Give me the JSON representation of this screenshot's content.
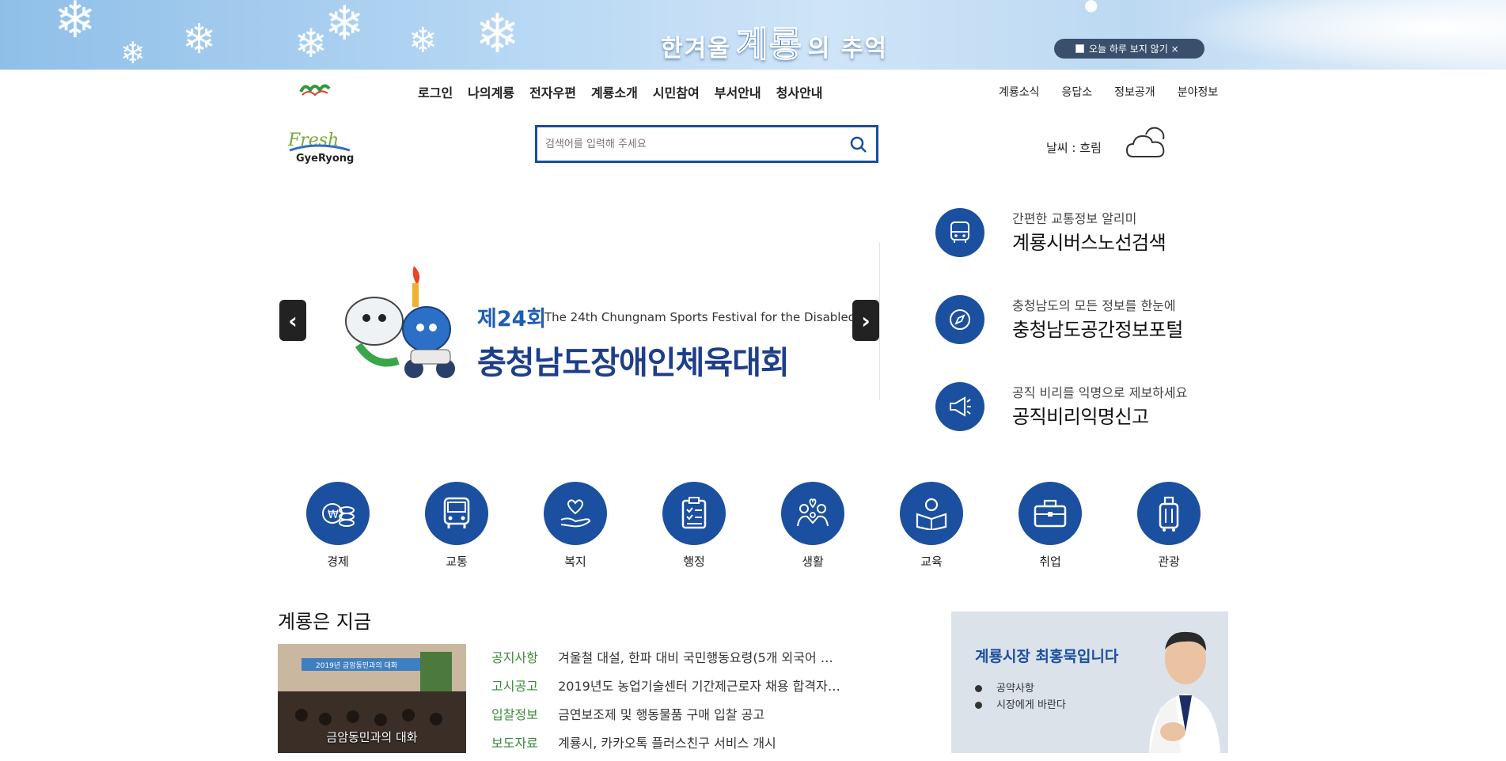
{
  "banner": {
    "title_left": "한겨울",
    "title_big": "계룡",
    "title_right": "의 추억",
    "close_today_label": "오늘 하루 보지 않기 ×"
  },
  "gnb": {
    "logo_text": "계룡시",
    "menu": [
      "로그인",
      "나의계룡",
      "전자우편",
      "계룡소개",
      "시민참여",
      "부서안내",
      "청사안내"
    ],
    "right_menu": [
      "계룡소식",
      "응답소",
      "정보공개",
      "분야정보"
    ]
  },
  "header": {
    "fresh_logo_top": "Fresh",
    "fresh_logo_bottom": "GyeRyong",
    "search_placeholder": "검색어를 입력해 주세요",
    "weather": "날씨 : 흐림"
  },
  "slider": {
    "prev": "‹",
    "next": "›",
    "festival_num": "제24회",
    "festival_en": "The 24th Chungnam Sports Festival for the Disabled",
    "festival_ko": "충청남도장애인체육대회"
  },
  "quick_links": [
    {
      "sub": "간편한 교통정보 알리미",
      "main": "계룡시버스노선검색",
      "icon": "bus-icon"
    },
    {
      "sub": "충청남도의 모든 정보를 한눈에",
      "main": "충청남도공간정보포털",
      "icon": "compass-icon"
    },
    {
      "sub": "공직 비리를 익명으로 제보하세요",
      "main": "공직비리익명신고",
      "icon": "megaphone-icon"
    }
  ],
  "categories": [
    {
      "label": "경제",
      "icon": "coins-icon"
    },
    {
      "label": "교통",
      "icon": "bus-icon"
    },
    {
      "label": "복지",
      "icon": "heart-hand-icon"
    },
    {
      "label": "행정",
      "icon": "clipboard-icon"
    },
    {
      "label": "생활",
      "icon": "family-icon"
    },
    {
      "label": "교육",
      "icon": "reading-icon"
    },
    {
      "label": "취업",
      "icon": "briefcase-icon"
    },
    {
      "label": "관광",
      "icon": "suitcase-icon"
    }
  ],
  "now": {
    "title": "계룡은 지금",
    "photo_caption": "금암동민과의 대화",
    "photo_banner": "2019년 금암동민과의 대화",
    "news": [
      {
        "category": "공지사항",
        "title": "겨울철 대설, 한파 대비 국민행동요령(5개 외국어 …"
      },
      {
        "category": "고시공고",
        "title": "2019년도 농업기술센터 기간제근로자 채용 합격자…"
      },
      {
        "category": "입찰정보",
        "title": "금연보조제 및 행동물품 구매 입찰 공고"
      },
      {
        "category": "보도자료",
        "title": "계룡시, 카카오톡 플러스친구 서비스 개시"
      }
    ]
  },
  "mayor": {
    "title": "계룡시장 최홍묵입니다",
    "links": [
      "공약사항",
      "시장에게 바란다"
    ]
  },
  "colors": {
    "primary": "#1b4fa0",
    "news_category": "#3b8a3a",
    "mayor_bg": "#dbe2ea"
  }
}
